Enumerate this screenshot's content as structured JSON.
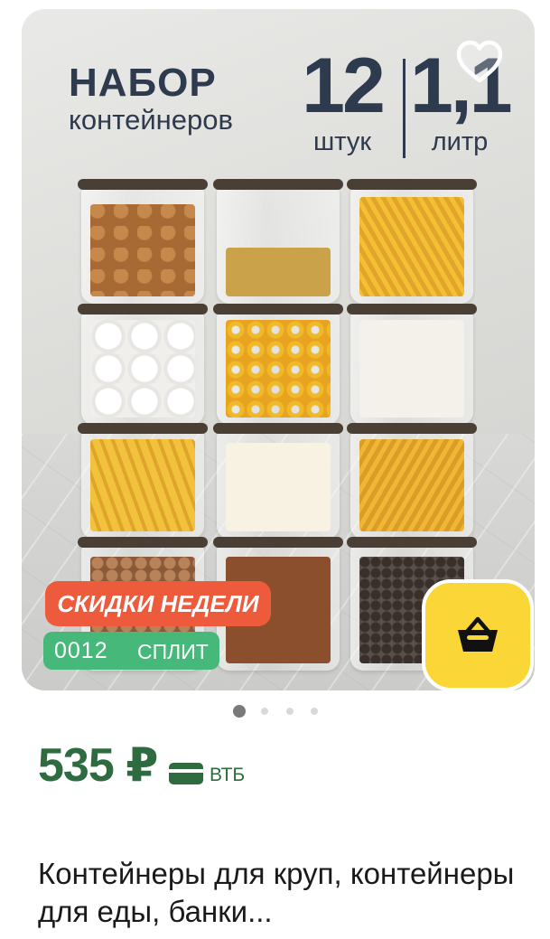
{
  "product_image": {
    "headline_title": "НАБОР",
    "headline_subtitle": "контейнеров",
    "count_number": "12",
    "count_unit": "штук",
    "volume_number": "1,1",
    "volume_unit": "литр"
  },
  "badges": {
    "sale": "СКИДКИ НЕДЕЛИ",
    "split_coins": "0012",
    "split_label": "СПЛИТ"
  },
  "carousel": {
    "total": 4,
    "active_index": 0
  },
  "price": {
    "value": "535 ₽",
    "bank": "ВТБ"
  },
  "product": {
    "title": "Контейнеры для круп, контейнеры для еды, банки..."
  },
  "icons": {
    "favorite": "heart-icon",
    "cart": "basket-icon",
    "payment": "bank-card-icon"
  },
  "colors": {
    "sale_badge": "#ee5a3c",
    "split_badge": "#46b97a",
    "cart_button": "#fbd637",
    "price": "#2e6b3f"
  }
}
